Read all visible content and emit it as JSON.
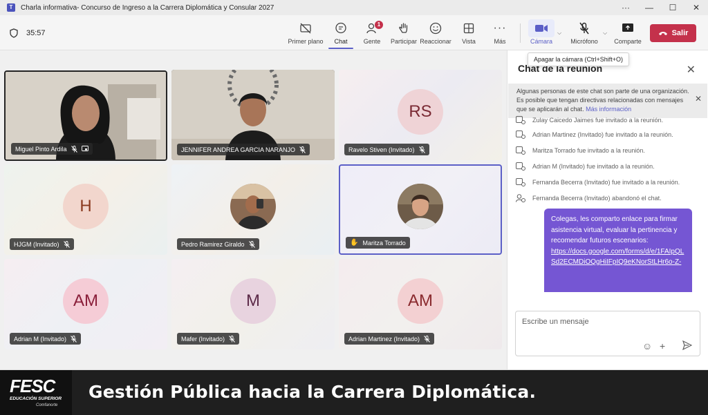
{
  "window": {
    "title": "Charla informativa- Concurso de Ingreso a la Carrera Diplomática y Consular 2027"
  },
  "toolbar": {
    "timer": "35:57",
    "buttons": [
      {
        "label": "Primer plano",
        "icon": "spotlight-off-icon"
      },
      {
        "label": "Chat",
        "icon": "chat-icon"
      },
      {
        "label": "Gente",
        "icon": "people-icon",
        "badge": "1"
      },
      {
        "label": "Participar",
        "icon": "raise-hand-icon"
      },
      {
        "label": "Reaccionar",
        "icon": "smile-icon"
      },
      {
        "label": "Vista",
        "icon": "grid-view-icon"
      },
      {
        "label": "Más",
        "icon": "more-icon"
      },
      {
        "label": "Cámara",
        "icon": "camera-icon"
      },
      {
        "label": "Micrófono",
        "icon": "mic-off-icon"
      },
      {
        "label": "Comparte",
        "icon": "share-icon"
      }
    ],
    "leave_label": "Salir",
    "tooltip": "Apagar la cámara (Ctrl+Shift+O)"
  },
  "participants": [
    {
      "name": "Miguel Pinto Ardila",
      "type": "video"
    },
    {
      "name": "JENNIFER ANDREA GARCIA NARANJO",
      "type": "video"
    },
    {
      "name": "Ravelo Stiven (Invitado)",
      "initials": "RS"
    },
    {
      "name": "HJGM (Invitado)",
      "initials": "H"
    },
    {
      "name": "Pedro Ramirez Giraldo",
      "type": "photo"
    },
    {
      "name": "Maritza Torrado",
      "type": "photo",
      "hand_raised": true
    },
    {
      "name": "Adrian M (Invitado)",
      "initials": "AM"
    },
    {
      "name": "Mafer (Invitado)",
      "initials": "M"
    },
    {
      "name": "Adrian Martinez (Invitado)",
      "initials": "AM"
    }
  ],
  "chat": {
    "title": "Chat de la reunión",
    "notice_text": "Algunas personas de este chat son parte de una organización. Es posible que tengan directivas relacionadas con mensajes que se aplicarán al chat.",
    "notice_link": "Más información",
    "system_messages": [
      "Zulay Caicedo Jaimes fue invitado a la reunión.",
      "Adrian Martinez (Invitado) fue invitado a la reunión.",
      "Maritza Torrado fue invitado a la reunión.",
      "Adrian M (Invitado) fue invitado a la reunión.",
      "Fernanda Becerra (Invitado) fue invitado a la reunión.",
      "Fernanda Becerra (Invitado) abandonó el chat."
    ],
    "message_text": "Colegas, les comparto enlace para firmar asistencia virtual, evaluar la pertinencia y recomendar futuros escenarios:",
    "message_link": "https://docs.google.com/forms/d/e/1FAIpQLSd2ECMDiOQgHiIFpIQ9eKNorStLHr6o-Z-",
    "composer_placeholder": "Escribe un mensaje"
  },
  "banner": {
    "logo": "FESC",
    "logo_sub": "EDUCACIÓN SUPERIOR",
    "logo_sub2": "Comfanorte",
    "headline": "Gestión Pública hacia la Carrera Diplomática."
  },
  "colors": {
    "accent": "#5b5fc7",
    "leave": "#c4314b",
    "bubble": "#7556d3"
  }
}
